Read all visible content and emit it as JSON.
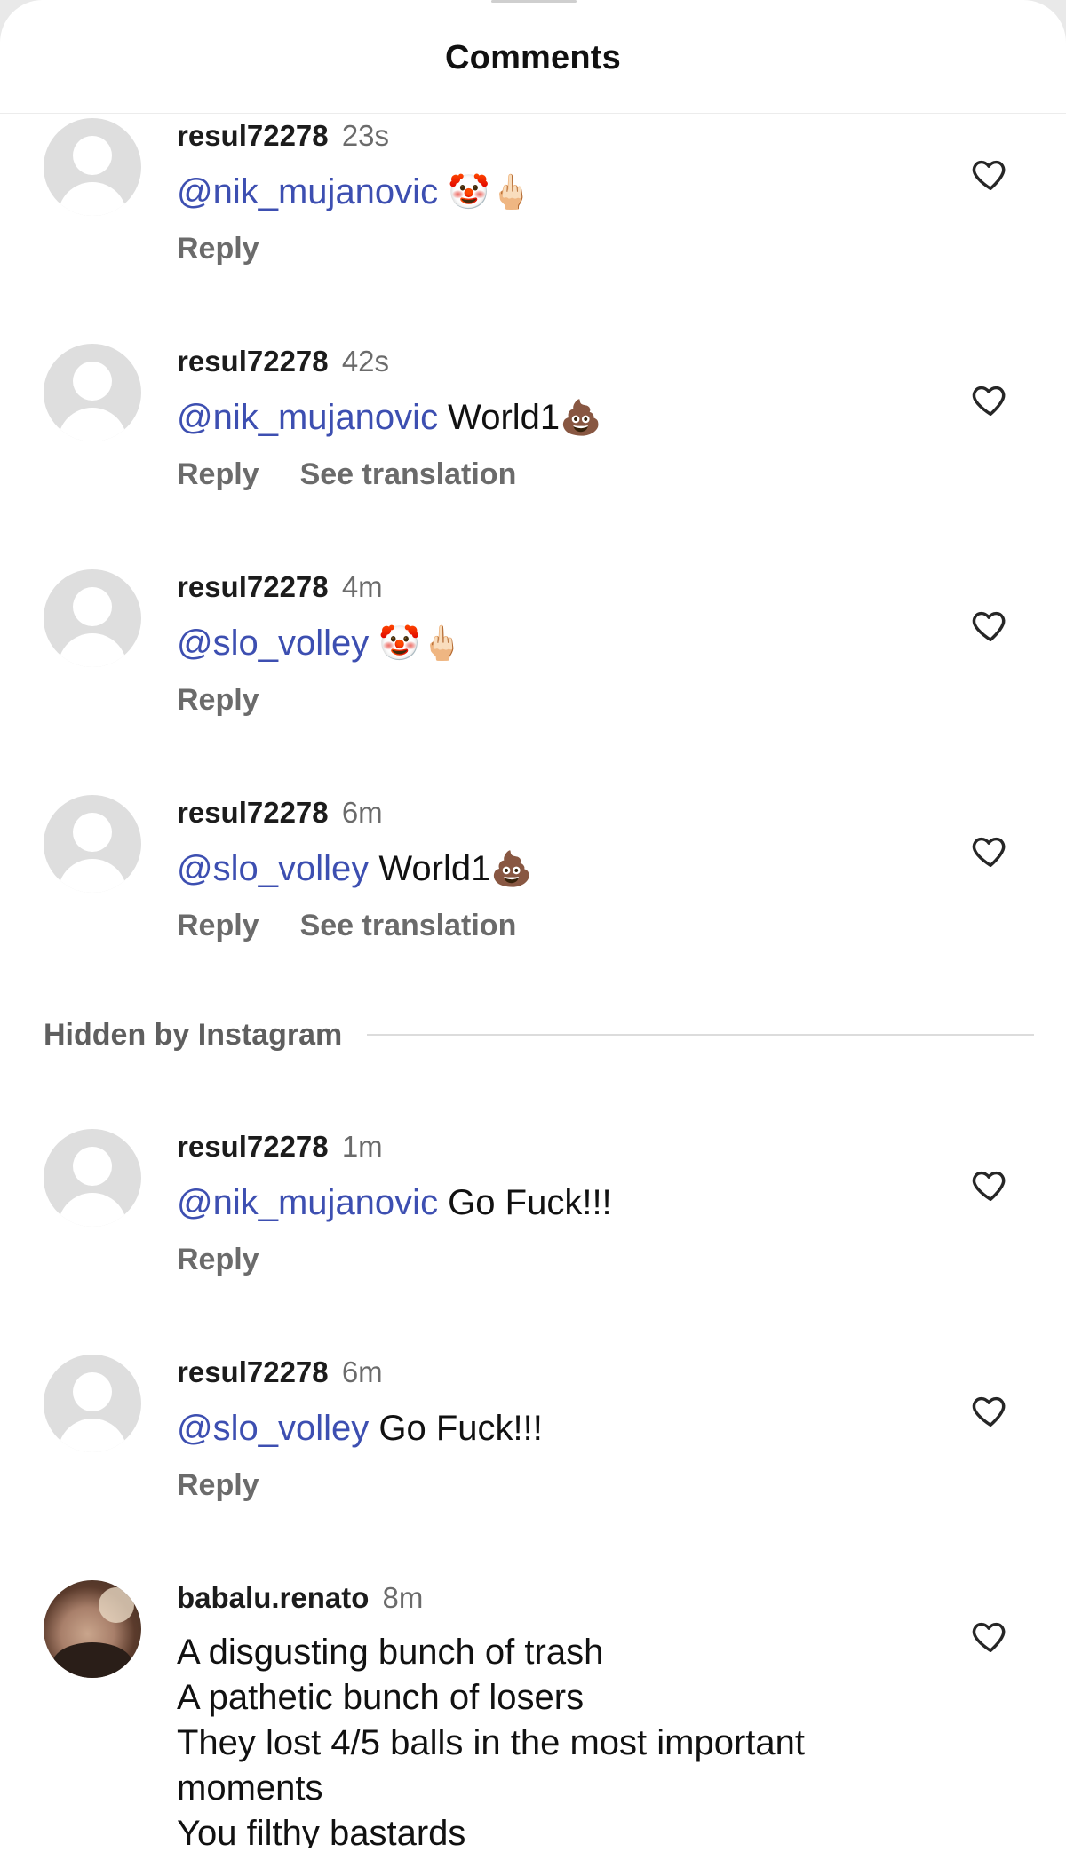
{
  "header": {
    "title": "Comments"
  },
  "comments": [
    {
      "username": "resul72278",
      "time": "23s",
      "mention": "@nik_mujanovic",
      "text": "",
      "emoji": "🤡🖕🏻",
      "reply": "Reply",
      "translate": ""
    },
    {
      "username": "resul72278",
      "time": "42s",
      "mention": "@nik_mujanovic",
      "text": " World1",
      "emoji": "💩",
      "reply": "Reply",
      "translate": "See translation"
    },
    {
      "username": "resul72278",
      "time": "4m",
      "mention": "@slo_volley",
      "text": "",
      "emoji": "🤡🖕🏻",
      "reply": "Reply",
      "translate": ""
    },
    {
      "username": "resul72278",
      "time": "6m",
      "mention": "@slo_volley",
      "text": " World1",
      "emoji": "💩",
      "reply": "Reply",
      "translate": "See translation"
    }
  ],
  "hidden_section": {
    "label": "Hidden by Instagram"
  },
  "hidden_comments": [
    {
      "username": "resul72278",
      "time": "1m",
      "mention": "@nik_mujanovic",
      "text": " Go Fuck!!!",
      "reply": "Reply"
    },
    {
      "username": "resul72278",
      "time": "6m",
      "mention": "@slo_volley",
      "text": " Go Fuck!!!",
      "reply": "Reply"
    },
    {
      "username": "babalu.renato",
      "time": "8m",
      "text": "A disgusting bunch of trash\nA pathetic bunch of losers\nThey lost 4/5 balls in the most important\nmoments\nYou filthy bastards"
    }
  ],
  "icons": {
    "like": "heart-outline-icon",
    "avatar": "default-avatar-icon"
  },
  "colors": {
    "mention": "#3d4fb1",
    "muted": "#6b6b6b",
    "avatar_bg": "#dedede"
  }
}
